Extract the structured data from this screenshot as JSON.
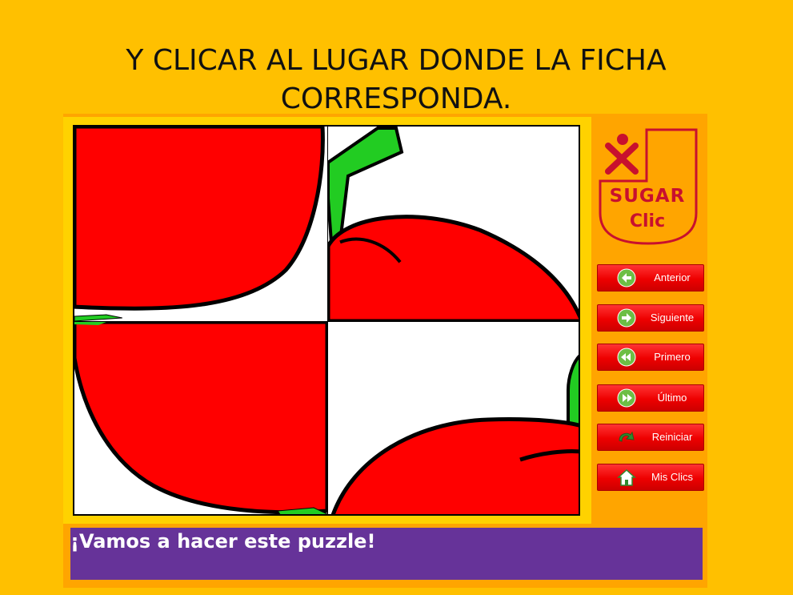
{
  "slide": {
    "title_line1": "Y CLICAR AL LUGAR DONDE LA FICHA",
    "title_line2": "CORRESPONDA."
  },
  "logo": {
    "line1": "SUGAR",
    "line2": "Clic",
    "color": "#C8102E"
  },
  "buttons": [
    {
      "label": "Anterior",
      "icon": "arrow-left-icon"
    },
    {
      "label": "Siguiente",
      "icon": "arrow-right-icon"
    },
    {
      "label": "Primero",
      "icon": "rewind-icon"
    },
    {
      "label": "Último",
      "icon": "fast-forward-icon"
    },
    {
      "label": "Reiniciar",
      "icon": "reload-icon"
    },
    {
      "label": "Mis Clics",
      "icon": "home-icon"
    }
  ],
  "status": {
    "message": "¡Vamos a hacer este puzzle!"
  },
  "colors": {
    "background": "#FFC000",
    "button": "#EE0000",
    "status_bar": "#663399",
    "apple": "#FF0000",
    "stem": "#22CC22"
  }
}
